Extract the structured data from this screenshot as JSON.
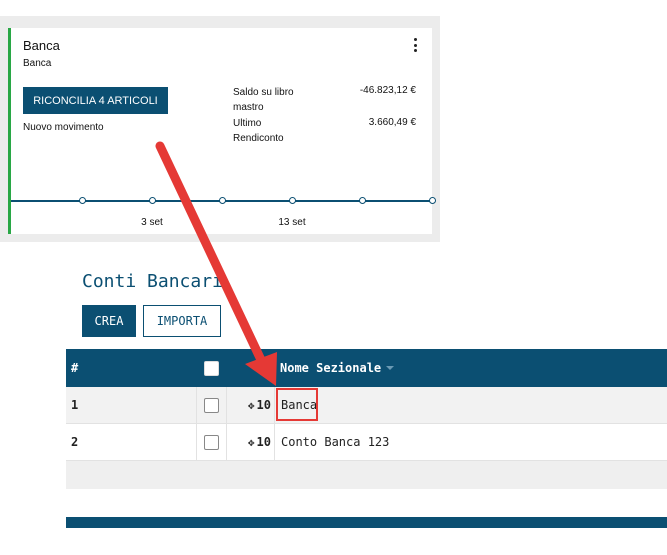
{
  "journal_card": {
    "title": "Banca",
    "subtitle": "Banca",
    "reconcile_button": "RICONCILIA 4 ARTICOLI",
    "new_movement_link": "Nuovo movimento",
    "stats": [
      {
        "label": "Saldo su libro mastro",
        "value": "-46.823,12 €"
      },
      {
        "label": "Ultimo Rendiconto",
        "value": "3.660,49 €"
      }
    ],
    "timeline_ticks": [
      "3 set",
      "13 set"
    ],
    "menu_icon": "kebab-vertical-icon",
    "accent_color": "#28a745"
  },
  "section": {
    "title": "Conti Bancari",
    "create_button": "CREA",
    "import_button": "IMPORTA"
  },
  "table": {
    "headers": {
      "number": "#",
      "name": "Nome Sezionale"
    },
    "rows": [
      {
        "number": "1",
        "sequence": "10",
        "name": "Banca"
      },
      {
        "number": "2",
        "sequence": "10",
        "name": "Conto Banca 123"
      }
    ],
    "drag_icon": "move-arrows-icon",
    "header_color": "#0b4f72"
  },
  "annotation": {
    "arrow_color": "#e53935",
    "highlight_color": "#e53935"
  }
}
